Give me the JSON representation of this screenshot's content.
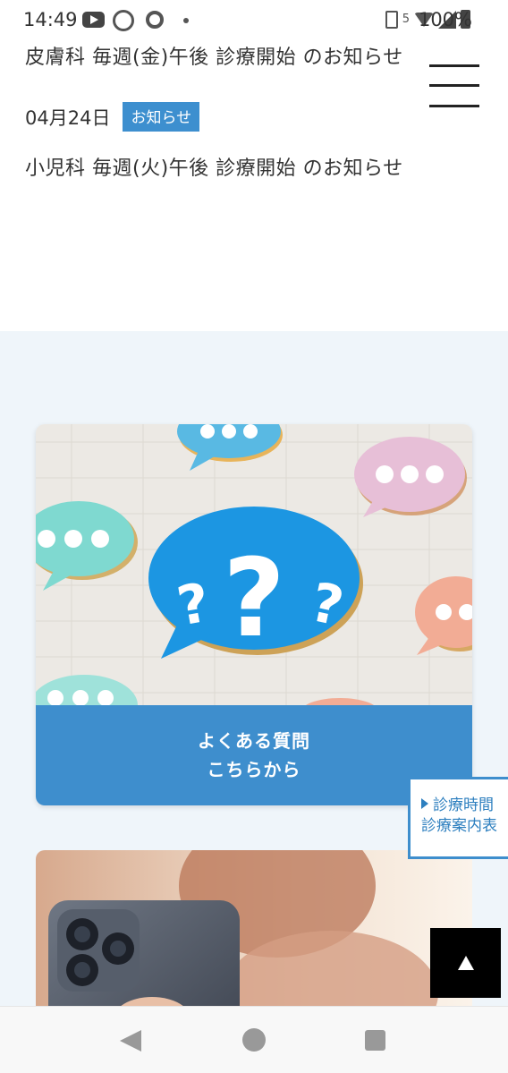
{
  "status_bar": {
    "time": "14:49",
    "battery": "100%",
    "data_indicator": "5",
    "icons": [
      "youtube-icon",
      "badge-icon",
      "chrome-icon",
      "notification-dot-icon",
      "nfc-icon",
      "data-arrows-icon",
      "wifi-icon",
      "signal-icon",
      "battery-icon"
    ]
  },
  "news": {
    "items": [
      {
        "title": "皮膚科 毎週(金)午後 診療開始 のお知らせ"
      },
      {
        "date": "04月24日",
        "tag": "お知らせ",
        "title": "小児科 毎週(火)午後 診療開始 のお知らせ"
      }
    ]
  },
  "faq_card": {
    "line1": "よくある質問",
    "line2": "こちらから",
    "image_icon": "question-speech-bubbles-photo"
  },
  "schedule_tab": {
    "line1": "診療時間",
    "line2": "診療案内表"
  },
  "page_top": {
    "icon": "up-arrow-icon"
  },
  "nav_bar": {
    "icons": [
      "back-icon",
      "home-icon",
      "recents-icon"
    ]
  },
  "colors": {
    "accent": "#3e8ecd",
    "tag": "#3d8fcf",
    "section_bg": "#eff5fa"
  }
}
